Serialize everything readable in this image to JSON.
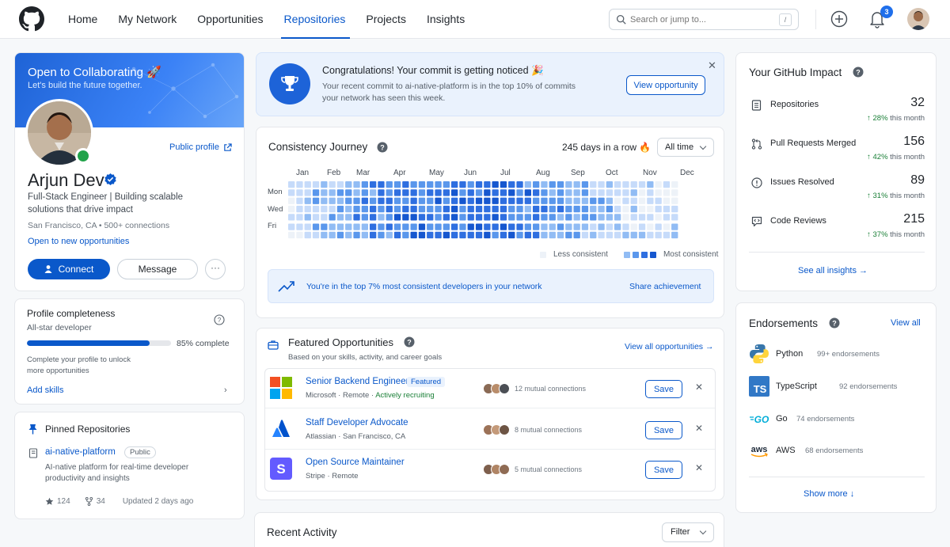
{
  "nav": {
    "links": [
      "Home",
      "My Network",
      "Opportunities",
      "Repositories",
      "Projects",
      "Insights"
    ],
    "active": "Repositories",
    "search_placeholder": "Search or jump to...",
    "search_shortcut": "/",
    "notification_count": "3"
  },
  "profile": {
    "banner_title": "Open to Collaborating 🚀",
    "banner_subtitle": "Let's build the future together.",
    "public_profile": "Public profile",
    "name": "Arjun Dev",
    "headline": "Full-Stack Engineer | Building scalable solutions that drive impact",
    "location": "San Francisco, CA  •  500+ connections",
    "open_to": "Open to new opportunities",
    "connect": "Connect",
    "message": "Message",
    "more": "···"
  },
  "completeness": {
    "title": "Profile completeness",
    "level": "All-star developer",
    "percent": 85,
    "percent_label": "85% complete",
    "note": "Complete your profile to unlock more opportunities",
    "action": "Add skills"
  },
  "pinned": {
    "title": "Pinned Repositories",
    "repo_name": "ai-native-platform",
    "visibility": "Public",
    "description": "AI-native platform for real-time developer productivity and insights",
    "stars": "124",
    "forks": "34",
    "updated": "Updated 2 days ago"
  },
  "congrats": {
    "title": "Congratulations! Your commit is getting noticed 🎉",
    "description": "Your recent commit to ai-native-platform is in the top 10% of commits your network has seen this week.",
    "button": "View opportunity",
    "close": "✕"
  },
  "consistency": {
    "title": "Consistency Journey",
    "streak": "245 days in a row 🔥",
    "range": "All time",
    "months": [
      "Jan",
      "Feb",
      "Mar",
      "Apr",
      "May",
      "Jun",
      "Jul",
      "Aug",
      "Sep",
      "Oct",
      "Nov",
      "Dec"
    ],
    "day_labels": [
      "Mon",
      "Wed",
      "Fri"
    ],
    "legend_less": "Less consistent",
    "legend_more": "Most consistent",
    "banner_text": "You're in the top 7% most consistent developers in your network",
    "share": "Share achievement",
    "colors": [
      "#edf2f8",
      "#c6dbfa",
      "#91bcf4",
      "#5a97ec",
      "#2f6fe0",
      "#1657cf"
    ]
  },
  "featured": {
    "title": "Featured Opportunities",
    "subtitle": "Based on your skills, activity, and career goals",
    "view_all": "View all opportunities →",
    "jobs": [
      {
        "title": "Senior Backend Engineer",
        "badge": "Featured",
        "company": "Microsoft",
        "location": "Remote",
        "status": "Actively recruiting",
        "mutual": "12 mutual connections",
        "save": "Save"
      },
      {
        "title": "Staff Developer Advocate",
        "badge": "",
        "company": "Atlassian",
        "location": "San Francisco, CA",
        "status": "",
        "mutual": "8 mutual connections",
        "save": "Save"
      },
      {
        "title": "Open Source Maintainer",
        "badge": "",
        "company": "Stripe",
        "location": "Remote",
        "status": "",
        "mutual": "5 mutual connections",
        "save": "Save"
      }
    ]
  },
  "recent": {
    "title": "Recent Activity",
    "filter": "Filter"
  },
  "impact": {
    "title": "Your GitHub Impact",
    "stats": [
      {
        "label": "Repositories",
        "value": "32",
        "change": "↑ 28%",
        "period": " this month",
        "icon": "repo-icon"
      },
      {
        "label": "Pull Requests Merged",
        "value": "156",
        "change": "↑ 42%",
        "period": " this month",
        "icon": "pull-request-icon"
      },
      {
        "label": "Issues Resolved",
        "value": "89",
        "change": "↑ 31%",
        "period": " this month",
        "icon": "issue-icon"
      },
      {
        "label": "Code Reviews",
        "value": "215",
        "change": "↑ 37%",
        "period": " this month",
        "icon": "code-review-icon"
      }
    ],
    "see_all": "See all insights →"
  },
  "endorsements": {
    "title": "Endorsements",
    "view_all": "View all",
    "items": [
      {
        "skill": "Python",
        "count": "99+ endorsements"
      },
      {
        "skill": "TypeScript",
        "count": "92 endorsements"
      },
      {
        "skill": "Go",
        "count": "74 endorsements"
      },
      {
        "skill": "AWS",
        "count": "68 endorsements"
      }
    ],
    "show_more": "Show more ↓"
  }
}
